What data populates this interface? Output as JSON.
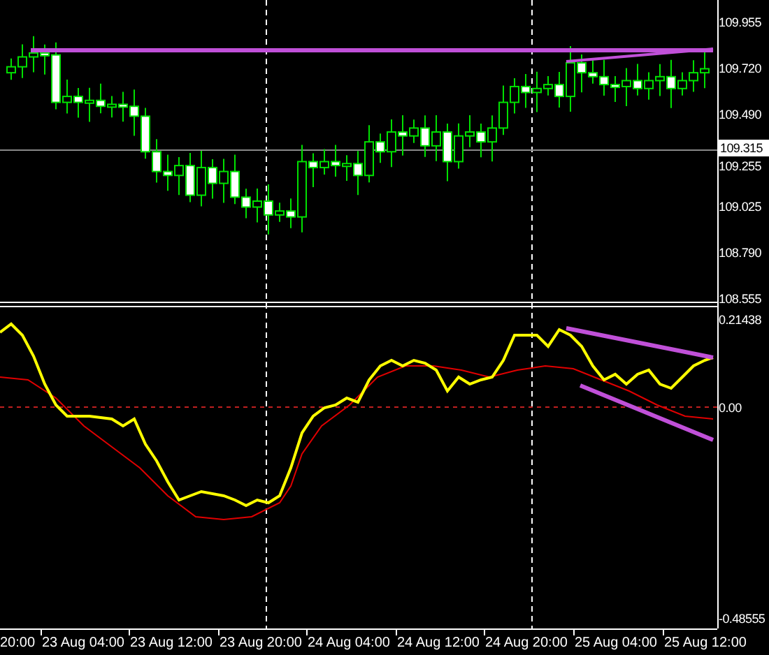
{
  "price_panel": {
    "axis_labels": [
      "109.955",
      "109.720",
      "109.490",
      "109.255",
      "109.025",
      "108.790",
      "108.555"
    ],
    "current_price": "109.315"
  },
  "indicator_panel": {
    "axis_labels": [
      "0.21438",
      "0.00",
      "-0.48555"
    ]
  },
  "time_axis": {
    "labels": [
      "20:00",
      "23 Aug 04:00",
      "23 Aug 12:00",
      "23 Aug 20:00",
      "24 Aug 04:00",
      "24 Aug 12:00",
      "24 Aug 20:00",
      "25 Aug 04:00",
      "25 Aug 12:00"
    ]
  }
}
